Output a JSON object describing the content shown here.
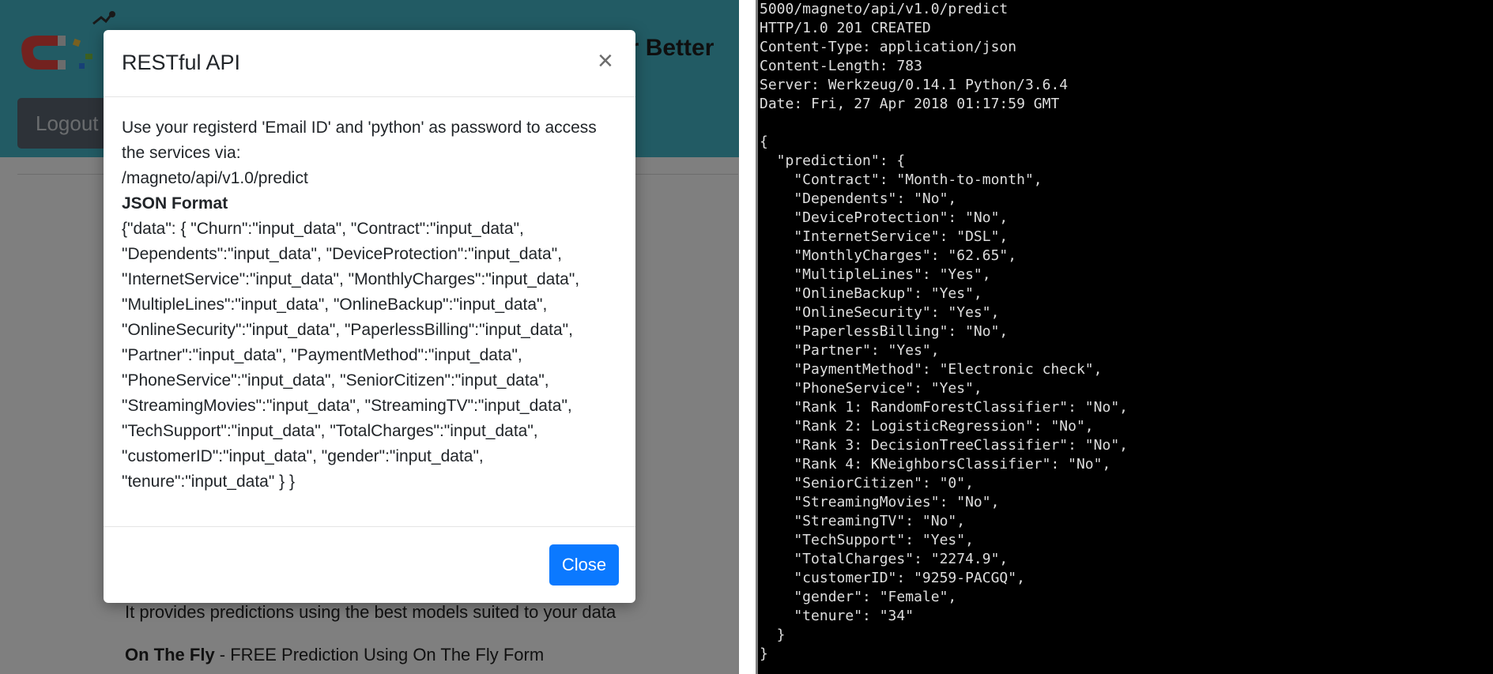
{
  "app": {
    "header_title_fragment": "er Better",
    "logout_label": "Logout",
    "intro_text": "It provides predictions using the best models suited to your data",
    "onthefly_bold": "On The Fly",
    "onthefly_rest": " - FREE Prediction Using On The Fly Form",
    "logo_icon": "magnet-logo-icon",
    "colors": {
      "header_bg": "#45b7c8",
      "logout_bg": "#5b6570",
      "primary_button": "#0b79ff"
    }
  },
  "modal": {
    "title": "RESTful API",
    "close_glyph": "×",
    "instructions": "Use your registerd 'Email ID' and 'python' as password to access the services via:",
    "endpoint": "/magneto/api/v1.0/predict",
    "json_heading": "JSON Format",
    "json_format": "{\"data\": { \"Churn\":\"input_data\", \"Contract\":\"input_data\", \"Dependents\":\"input_data\", \"DeviceProtection\":\"input_data\", \"InternetService\":\"input_data\", \"MonthlyCharges\":\"input_data\", \"MultipleLines\":\"input_data\", \"OnlineBackup\":\"input_data\", \"OnlineSecurity\":\"input_data\", \"PaperlessBilling\":\"input_data\", \"Partner\":\"input_data\", \"PaymentMethod\":\"input_data\", \"PhoneService\":\"input_data\", \"SeniorCitizen\":\"input_data\", \"StreamingMovies\":\"input_data\", \"StreamingTV\":\"input_data\", \"TechSupport\":\"input_data\", \"TotalCharges\":\"input_data\", \"customerID\":\"input_data\", \"gender\":\"input_data\", \"tenure\":\"input_data\" } }",
    "close_button_label": "Close"
  },
  "terminal": {
    "output": "5000/magneto/api/v1.0/predict\nHTTP/1.0 201 CREATED\nContent-Type: application/json\nContent-Length: 783\nServer: Werkzeug/0.14.1 Python/3.6.4\nDate: Fri, 27 Apr 2018 01:17:59 GMT\n\n{\n  \"prediction\": {\n    \"Contract\": \"Month-to-month\",\n    \"Dependents\": \"No\",\n    \"DeviceProtection\": \"No\",\n    \"InternetService\": \"DSL\",\n    \"MonthlyCharges\": \"62.65\",\n    \"MultipleLines\": \"Yes\",\n    \"OnlineBackup\": \"Yes\",\n    \"OnlineSecurity\": \"Yes\",\n    \"PaperlessBilling\": \"No\",\n    \"Partner\": \"Yes\",\n    \"PaymentMethod\": \"Electronic check\",\n    \"PhoneService\": \"Yes\",\n    \"Rank 1: RandomForestClassifier\": \"No\",\n    \"Rank 2: LogisticRegression\": \"No\",\n    \"Rank 3: DecisionTreeClassifier\": \"No\",\n    \"Rank 4: KNeighborsClassifier\": \"No\",\n    \"SeniorCitizen\": \"0\",\n    \"StreamingMovies\": \"No\",\n    \"StreamingTV\": \"No\",\n    \"TechSupport\": \"Yes\",\n    \"TotalCharges\": \"2274.9\",\n    \"customerID\": \"9259-PACGQ\",\n    \"gender\": \"Female\",\n    \"tenure\": \"34\"\n  }\n}"
  }
}
